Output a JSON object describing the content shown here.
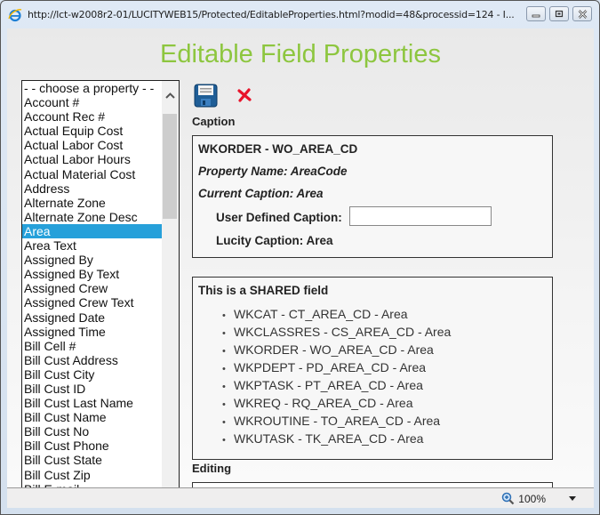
{
  "window": {
    "title": "http://lct-w2008r2-01/LUCITYWEB15/Protected/EditableProperties.html?modid=48&processid=124 - I...",
    "buttons": [
      "minimize",
      "maximize",
      "close"
    ]
  },
  "page": {
    "title": "Editable Field Properties",
    "title_color": "#8dc63f"
  },
  "property_list": {
    "selected": "Area",
    "items": [
      "- - choose a property - -",
      "Account #",
      "Account Rec #",
      "Actual Equip Cost",
      "Actual Labor Cost",
      "Actual Labor Hours",
      "Actual Material Cost",
      "Address",
      "Alternate Zone",
      "Alternate Zone Desc",
      "Area",
      "Area Text",
      "Assigned By",
      "Assigned By Text",
      "Assigned Crew",
      "Assigned Crew Text",
      "Assigned Date",
      "Assigned Time",
      "Bill Cell #",
      "Bill Cust Address",
      "Bill Cust City",
      "Bill Cust ID",
      "Bill Cust Last Name",
      "Bill Cust Name",
      "Bill Cust No",
      "Bill Cust Phone",
      "Bill Cust State",
      "Bill Cust Zip",
      "Bill E-mail"
    ]
  },
  "toolbar": {
    "save_icon": "floppy-disk",
    "cancel_icon": "red-x"
  },
  "caption": {
    "section_label": "Caption",
    "field_id": "WKORDER - WO_AREA_CD",
    "property_name": "Property Name: AreaCode",
    "current_caption": "Current Caption:  Area",
    "user_defined_label": "User Defined Caption:",
    "user_defined_value": "",
    "lucity_caption": "Lucity Caption: Area"
  },
  "shared": {
    "title": "This is a SHARED field",
    "items": [
      "WKCAT - CT_AREA_CD - Area",
      "WKCLASSRES - CS_AREA_CD - Area",
      "WKORDER - WO_AREA_CD - Area",
      "WKPDEPT - PD_AREA_CD - Area",
      "WKPTASK - PT_AREA_CD - Area",
      "WKREQ - RQ_AREA_CD - Area",
      "WKROUTINE - TO_AREA_CD - Area",
      "WKUTASK - TK_AREA_CD - Area"
    ]
  },
  "editing": {
    "section_label": "Editing"
  },
  "statusbar": {
    "zoom_level": "100%"
  }
}
